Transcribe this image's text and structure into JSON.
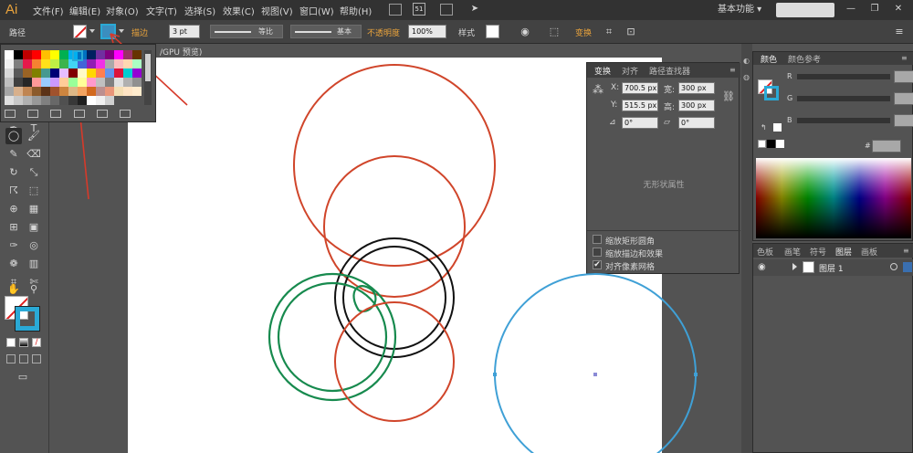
{
  "app": {
    "logo": "Ai",
    "workspace": "基本功能"
  },
  "menu": {
    "items": [
      "文件(F)",
      "编辑(E)",
      "对象(O)",
      "文字(T)",
      "选择(S)",
      "效果(C)",
      "视图(V)",
      "窗口(W)",
      "帮助(H)"
    ]
  },
  "control_bar": {
    "selection_label": "路径",
    "stroke_label": "描边",
    "stroke_weight": "3 pt",
    "profile_label": "等比",
    "brush_label": "基本",
    "opacity_label": "不透明度",
    "opacity_value": "100%",
    "style_label": "样式",
    "transform_label": "变换"
  },
  "document": {
    "tab_label": "/GPU 预览)"
  },
  "transform_panel": {
    "tabs": [
      "变换",
      "对齐",
      "路径查找器"
    ],
    "x_label": "X:",
    "x_value": "700.5 px",
    "y_label": "Y:",
    "y_value": "515.5 px",
    "w_label": "宽:",
    "w_value": "300 px",
    "h_label": "高:",
    "h_value": "300 px",
    "rotate_value": "0°",
    "shear_value": "0°",
    "empty_message": "无形状属性",
    "options": [
      {
        "label": "缩放矩形圆角",
        "checked": false
      },
      {
        "label": "缩放描边和效果",
        "checked": false
      },
      {
        "label": "对齐像素网格",
        "checked": true
      }
    ],
    "checkmark": "✔"
  },
  "color_panel": {
    "tabs": [
      "颜色",
      "颜色参考"
    ],
    "channels": [
      "R",
      "G",
      "B"
    ],
    "hex_symbol": "#"
  },
  "layers_panel": {
    "tabs": [
      "色板",
      "画笔",
      "符号",
      "图层",
      "画板"
    ],
    "layers": [
      {
        "name": "图层 1"
      }
    ]
  },
  "colors": {
    "red_circle": "#d0452a",
    "black_circle": "#111111",
    "green_circle": "#178a4e",
    "blue_circle": "#3fa0d6",
    "selection": "#2aa9d6",
    "arrow": "#d63a2a",
    "accent_label": "#e9a33c"
  },
  "icons": {
    "tools": [
      "select-arrow-icon",
      "direct-select-icon",
      "magic-wand-icon",
      "lasso-icon",
      "pen-icon",
      "type-icon",
      "line-icon",
      "ellipse-icon",
      "paintbrush-icon",
      "pencil-icon",
      "eraser-icon",
      "rotate-icon",
      "scale-icon",
      "warp-icon",
      "free-transform-icon",
      "shape-builder-icon",
      "perspective-icon",
      "mesh-icon",
      "gradient-icon",
      "eyedropper-icon",
      "blend-icon",
      "symbol-sprayer-icon",
      "column-graph-icon",
      "artboard-icon",
      "slice-icon",
      "hand-icon",
      "zoom-icon"
    ]
  }
}
